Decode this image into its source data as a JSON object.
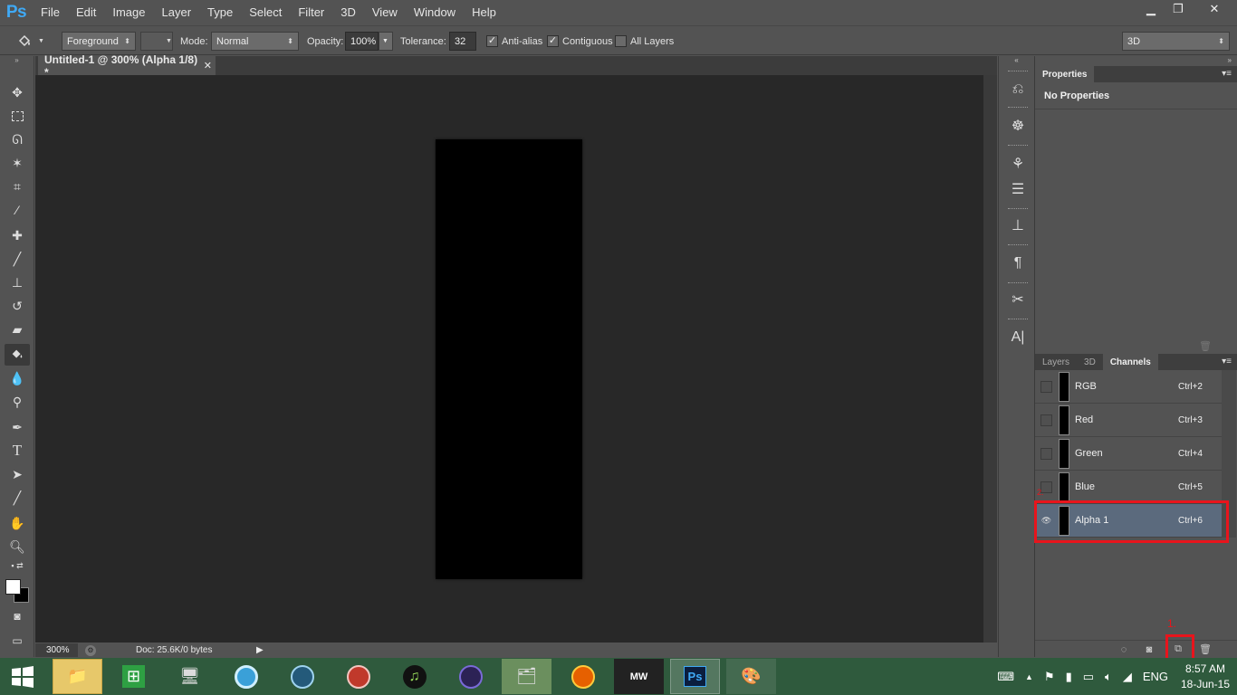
{
  "app": {
    "logo": "Ps"
  },
  "menu": [
    "File",
    "Edit",
    "Image",
    "Layer",
    "Type",
    "Select",
    "Filter",
    "3D",
    "View",
    "Window",
    "Help"
  ],
  "window_controls": {
    "minimize": "▁",
    "restore": "❐",
    "close": "✕"
  },
  "options": {
    "fill_source": "Foreground",
    "mode_label": "Mode:",
    "mode_value": "Normal",
    "opacity_label": "Opacity:",
    "opacity_value": "100%",
    "tolerance_label": "Tolerance:",
    "tolerance_value": "32",
    "antialias_label": "Anti-alias",
    "antialias_checked": true,
    "contiguous_label": "Contiguous",
    "contiguous_checked": true,
    "all_layers_label": "All Layers",
    "all_layers_checked": false,
    "workspace": "3D"
  },
  "document": {
    "tab_title": "Untitled-1 @ 300% (Alpha 1/8) *",
    "zoom": "300%",
    "doc_info": "Doc: 25.6K/0 bytes"
  },
  "properties_panel": {
    "tab": "Properties",
    "content": "No Properties"
  },
  "channels_panel": {
    "tabs": [
      "Layers",
      "3D",
      "Channels"
    ],
    "active_tab": "Channels",
    "channels": [
      {
        "name": "RGB",
        "shortcut": "Ctrl+2",
        "visible": false
      },
      {
        "name": "Red",
        "shortcut": "Ctrl+3",
        "visible": false
      },
      {
        "name": "Green",
        "shortcut": "Ctrl+4",
        "visible": false
      },
      {
        "name": "Blue",
        "shortcut": "Ctrl+5",
        "visible": false
      },
      {
        "name": "Alpha 1",
        "shortcut": "Ctrl+6",
        "visible": true,
        "selected": true
      }
    ]
  },
  "annotations": {
    "step1": "1.",
    "step2": "2."
  },
  "colors": {
    "highlight": "#e8141c",
    "selected_row": "#5b6a7d",
    "taskbar": "#2f5a3d",
    "ps_blue": "#3fa9f5"
  },
  "taskbar": {
    "apps": [
      "file-explorer",
      "store",
      "system-tool",
      "media-disc",
      "video-player",
      "audio-app",
      "music-player",
      "eclipse",
      "folder-app",
      "firefox",
      "nfs-mw",
      "photoshop",
      "paint"
    ],
    "active_app": "photoshop",
    "language": "ENG",
    "time": "8:57 AM",
    "date": "18-Jun-15"
  }
}
